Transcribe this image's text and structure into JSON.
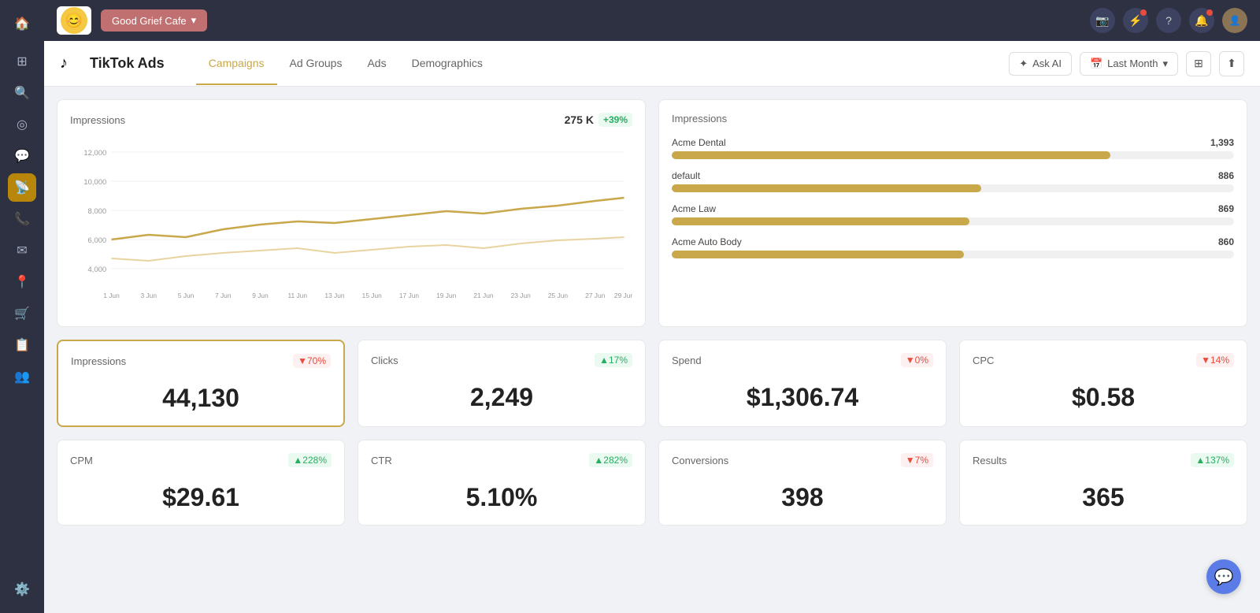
{
  "app": {
    "name": "Good Grief Cafe",
    "logo_emoji": "😊"
  },
  "topbar": {
    "icons": [
      "📷",
      "⚡",
      "?",
      "🔔",
      "👤"
    ]
  },
  "page": {
    "platform_icon": "♪",
    "platform_name": "TikTok Ads",
    "tabs": [
      {
        "label": "Campaigns",
        "active": true
      },
      {
        "label": "Ad Groups",
        "active": false
      },
      {
        "label": "Ads",
        "active": false
      },
      {
        "label": "Demographics",
        "active": false
      }
    ],
    "actions": {
      "ask_ai": "Ask AI",
      "date_range": "Last Month",
      "columns_icon": "⊞",
      "share_icon": "⬆"
    }
  },
  "impressions_chart": {
    "title": "Impressions",
    "value": "275 K",
    "trend": "+39%",
    "trend_dir": "up",
    "y_labels": [
      "12,000",
      "10,000",
      "8,000",
      "6,000",
      "4,000"
    ],
    "x_labels": [
      "1 Jun",
      "3 Jun",
      "5 Jun",
      "7 Jun",
      "9 Jun",
      "11 Jun",
      "13 Jun",
      "15 Jun",
      "17 Jun",
      "19 Jun",
      "21 Jun",
      "23 Jun",
      "25 Jun",
      "27 Jun",
      "29 Jun"
    ]
  },
  "impressions_bar": {
    "title": "Impressions",
    "items": [
      {
        "label": "Acme Dental",
        "value": "1,393",
        "pct": 78
      },
      {
        "label": "default",
        "value": "886",
        "pct": 55
      },
      {
        "label": "Acme Law",
        "value": "869",
        "pct": 53
      },
      {
        "label": "Acme Auto Body",
        "value": "860",
        "pct": 52
      }
    ]
  },
  "metrics": [
    {
      "label": "Impressions",
      "value": "44,130",
      "trend": "▼70%",
      "trend_dir": "down"
    },
    {
      "label": "Clicks",
      "value": "2,249",
      "trend": "▲17%",
      "trend_dir": "up"
    },
    {
      "label": "Spend",
      "value": "$1,306.74",
      "trend": "▼0%",
      "trend_dir": "down"
    },
    {
      "label": "CPC",
      "value": "$0.58",
      "trend": "▼14%",
      "trend_dir": "down"
    },
    {
      "label": "CPM",
      "value": "$29.61",
      "trend": "▲228%",
      "trend_dir": "up"
    },
    {
      "label": "CTR",
      "value": "5.10%",
      "trend": "▲282%",
      "trend_dir": "up"
    },
    {
      "label": "Conversions",
      "value": "398",
      "trend": "▼7%",
      "trend_dir": "down"
    },
    {
      "label": "Results",
      "value": "365",
      "trend": "▲137%",
      "trend_dir": "up"
    }
  ],
  "sidebar": {
    "icons": [
      "🏠",
      "⊞",
      "🔍",
      "◎",
      "💬",
      "📡",
      "📞",
      "✉",
      "📍",
      "🛒",
      "📋",
      "👥",
      "⚙️",
      "⚙"
    ]
  }
}
